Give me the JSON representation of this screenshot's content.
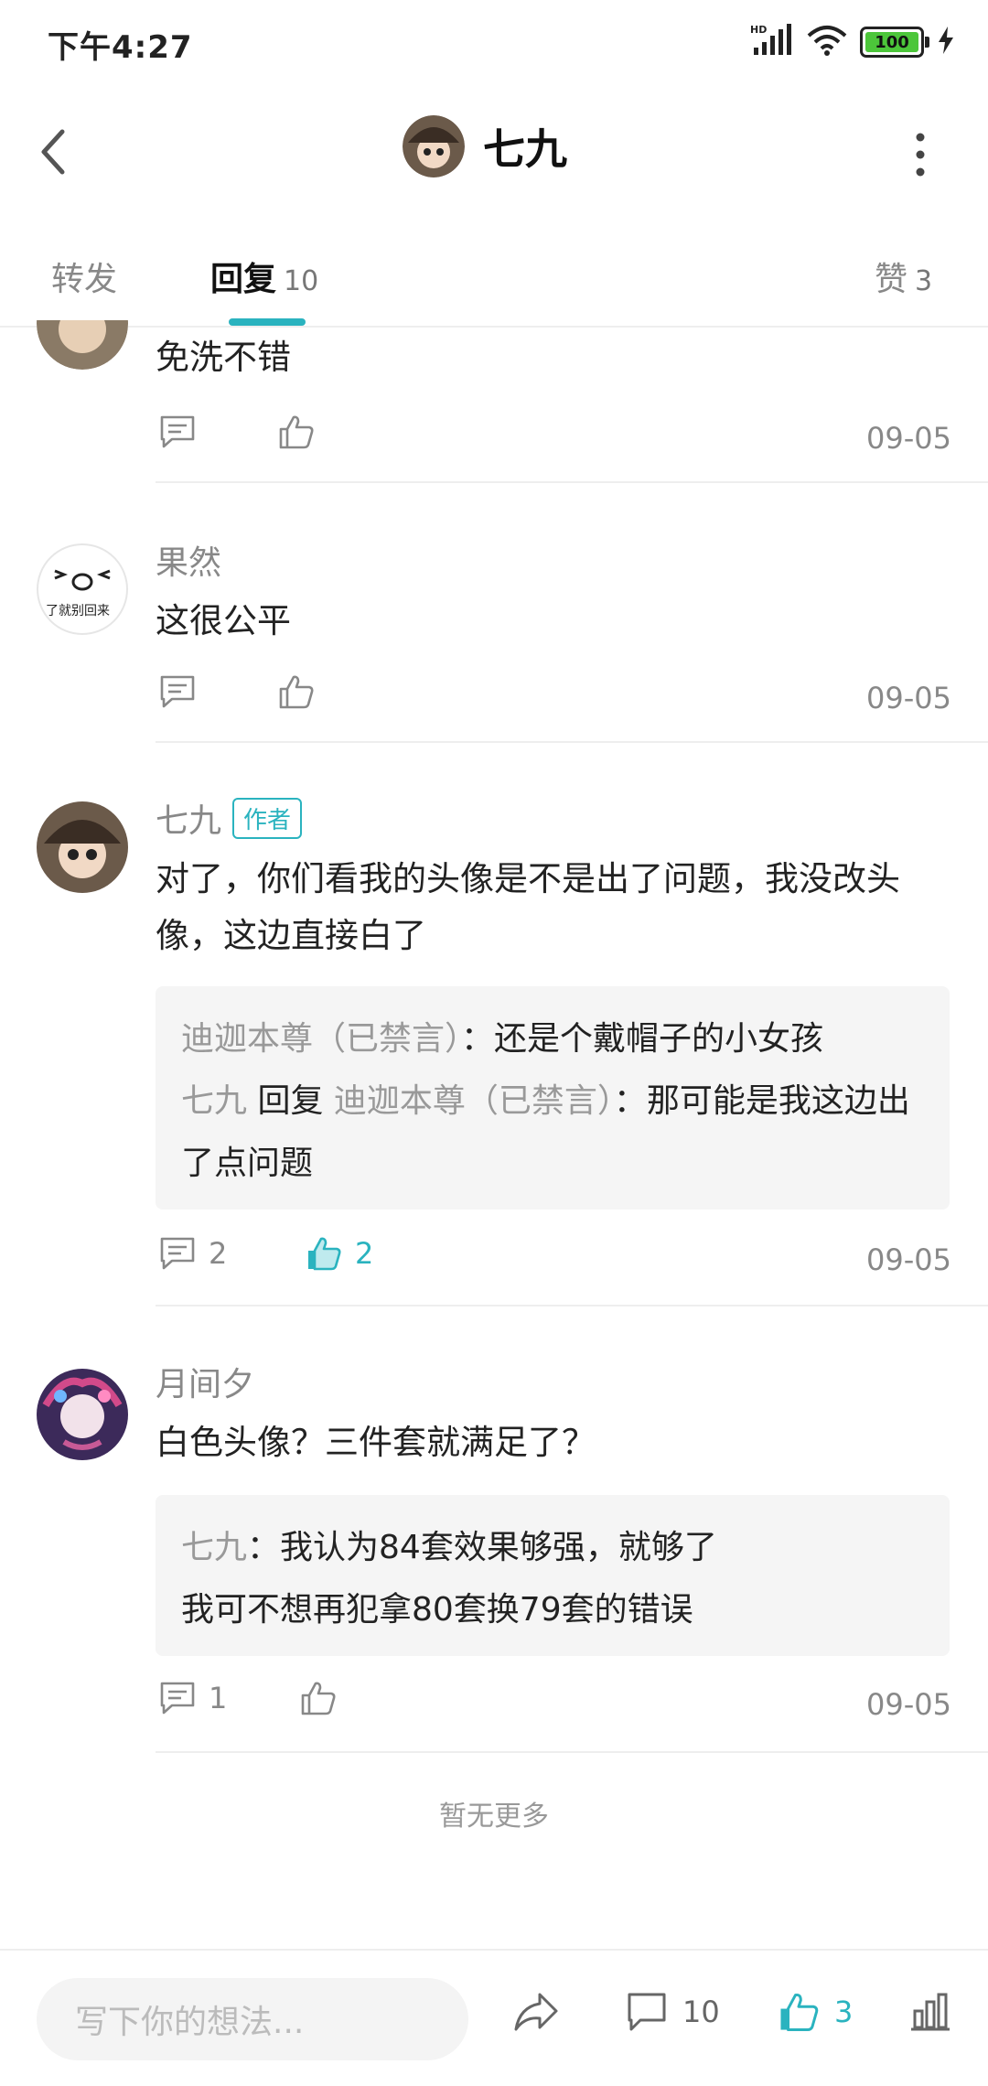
{
  "status_bar": {
    "time": "下午4:27",
    "battery": "100",
    "network": "HD"
  },
  "header": {
    "title": "七九"
  },
  "tabs": [
    {
      "label": "转发",
      "count": ""
    },
    {
      "label": "回复",
      "count": "10"
    },
    {
      "label": "赞",
      "count": "3"
    }
  ],
  "comments": [
    {
      "name": "",
      "text": "免洗不错",
      "reply_count": "",
      "like_count": "",
      "date": "09-05"
    },
    {
      "name": "果然",
      "text": "这很公平",
      "reply_count": "",
      "like_count": "",
      "date": "09-05"
    },
    {
      "name": "七九",
      "badge": "作者",
      "text": "对了，你们看我的头像是不是出了问题，我没改头像，这边直接白了",
      "replies": [
        {
          "from": "迪迦本尊（已禁言）",
          "to": "",
          "text": "：还是个戴帽子的小女孩"
        },
        {
          "from": "七九",
          "verb": " 回复 ",
          "to": "迪迦本尊（已禁言）",
          "text": "：那可能是我这边出了点问题"
        }
      ],
      "reply_count": "2",
      "like_count": "2",
      "date": "09-05"
    },
    {
      "name": "月间夕",
      "text": "白色头像？三件套就满足了？",
      "replies": [
        {
          "from": "七九",
          "text": "：我认为84套效果够强，就够了",
          "text2": "我可不想再犯拿80套换79套的错误"
        }
      ],
      "reply_count": "1",
      "like_count": "",
      "date": "09-05"
    }
  ],
  "no_more": "暂无更多",
  "bottom": {
    "placeholder": "写下你的想法...",
    "comment_count": "10",
    "like_count": "3"
  },
  "colors": {
    "accent": "#2ab3bf",
    "gray_text": "#888888",
    "reply_bg": "#f5f5f5"
  }
}
